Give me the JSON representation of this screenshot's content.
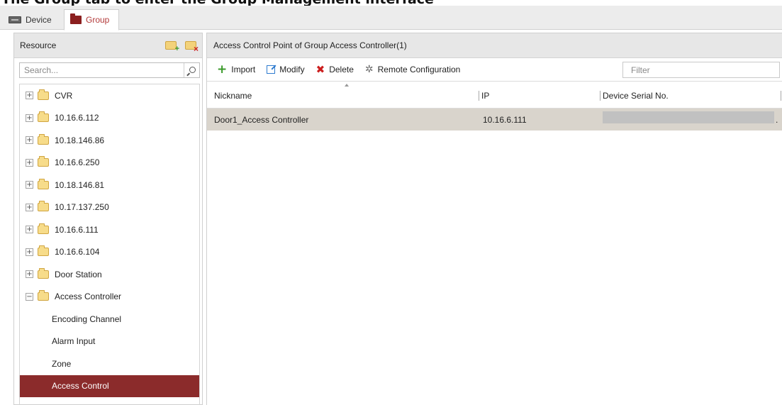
{
  "caption": "The Group tab to enter the Group Management interface",
  "tabs": {
    "device_label": "Device",
    "group_label": "Group"
  },
  "resource": {
    "title": "Resource",
    "search_placeholder": "Search...",
    "tree": [
      {
        "label": "CVR",
        "expander": "+"
      },
      {
        "label": "10.16.6.112",
        "expander": "+"
      },
      {
        "label": "10.18.146.86",
        "expander": "+"
      },
      {
        "label": "10.16.6.250",
        "expander": "+"
      },
      {
        "label": "10.18.146.81",
        "expander": "+"
      },
      {
        "label": "10.17.137.250",
        "expander": "+"
      },
      {
        "label": "10.16.6.111",
        "expander": "+"
      },
      {
        "label": "10.16.6.104",
        "expander": "+"
      },
      {
        "label": "Door Station",
        "expander": "+"
      },
      {
        "label": "Access Controller",
        "expander": "−"
      }
    ],
    "children": [
      {
        "label": "Encoding Channel"
      },
      {
        "label": "Alarm Input"
      },
      {
        "label": "Zone"
      },
      {
        "label": "Access Control",
        "selected": true
      }
    ]
  },
  "main": {
    "title": "Access Control Point of Group Access Controller(1)",
    "toolbar": {
      "import_label": "Import",
      "modify_label": "Modify",
      "delete_label": "Delete",
      "remote_label": "Remote Configuration",
      "filter_placeholder": "Filter"
    },
    "columns": {
      "nickname": "Nickname",
      "ip": "IP",
      "serial": "Device Serial No."
    },
    "rows": [
      {
        "nickname": "Door1_Access Controller",
        "ip": "10.16.6.111",
        "serial_tail": "."
      }
    ]
  },
  "colors": {
    "selected_bg": "#8b2b2b",
    "row_bg": "#d9d4cc",
    "group_tab_text": "#b33a3a"
  }
}
